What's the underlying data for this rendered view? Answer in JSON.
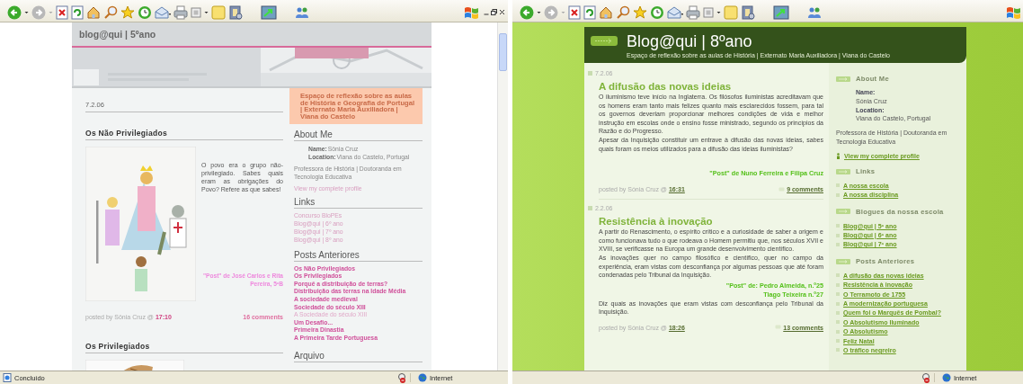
{
  "left_window": {
    "blog": {
      "title": "blog@qui | 5ºano",
      "description": "Espaço de reflexão sobre as aulas de História e Geografia de Portugal | Externato Maria Auxiliadora | Viana do Castelo",
      "date": "7.2.06",
      "posts": [
        {
          "title": "Os Não Privilegiados",
          "text": "O povo era o grupo não-privilegiado. Sabes quais eram as obrigações do Povo? Refere as que sabes!",
          "credit": "\"Post\" de José Carlos e Rita Pereira, 5ºB",
          "posted_by": "posted by Sônia Cruz @",
          "time": "17:10",
          "comments": "16 comments"
        },
        {
          "title": "Os Privilegiados"
        }
      ],
      "about": {
        "heading": "About Me",
        "name_label": "Name:",
        "name": "Sônia Cruz",
        "location_label": "Location:",
        "location": "Viana do Castelo, Portugal",
        "bio": "Professora de História | Doutoranda em Tecnologia Educativa",
        "profile_link": "View my complete profile"
      },
      "links": {
        "heading": "Links",
        "items": [
          "Concurso BloPEs",
          "Blog@qui | 6º ano",
          "Blog@qui | 7º ano",
          "Blog@qui | 8º ano"
        ]
      },
      "previous_posts": {
        "heading": "Posts Anteriores",
        "items": [
          {
            "label": "Os Não Privilegiados",
            "visited": false
          },
          {
            "label": "Os Privilegiados",
            "visited": false
          },
          {
            "label": "Porquê a distribuição de terras?",
            "visited": false
          },
          {
            "label": "Distribuição das terras na Idade Média",
            "visited": false
          },
          {
            "label": "A sociedade medieval",
            "visited": false
          },
          {
            "label": "Sociedade do século XIII",
            "visited": false
          },
          {
            "label": "A Sociedade do século XIII",
            "visited": true
          },
          {
            "label": "Um Desafio...",
            "visited": false
          },
          {
            "label": "Primeira Dinastia",
            "visited": false
          },
          {
            "label": "A Primeira Tarde Portuguesa",
            "visited": false
          }
        ]
      },
      "archive_heading": "Arquivo"
    },
    "status_bar": {
      "text": "Concluído",
      "zone": "Internet"
    }
  },
  "right_window": {
    "blog": {
      "title": "Blog@qui | 8ºano",
      "subtitle": "Espaço de reflexão sobre as aulas de História | Externato Maria Auxiliadora | Viana do Castelo",
      "posts": [
        {
          "date": "7.2.06",
          "title": "A difusão das novas ideias",
          "blocks": [
            {
              "kind": "text",
              "text": "O iluminismo teve início na Inglaterra. Os filósofos iluministas acreditavam que os homens eram tanto mais felizes quanto mais esclarecidos fossem, para tal os governos deveriam proporcionar melhores condições de vida e melhor instrução em escolas onde o ensino fosse ministrado, segundo os princípios da Razão e do Progresso."
            },
            {
              "kind": "text",
              "text": "Apesar da Inquisição constituir um entrave à difusão das novas ideias, sabes quais foram os meios utilizados para a difusão das ideias iluministas?"
            },
            {
              "kind": "credit",
              "text": "\"Post\" de Nuno Ferreira e Filipa Cruz"
            }
          ],
          "posted_by": "posted by Sónia Cruz @",
          "time": "16:31",
          "comments": "9 comments"
        },
        {
          "date": "2.2.06",
          "title": "Resistência à inovação",
          "blocks": [
            {
              "kind": "text",
              "text": "A partir do Renascimento, o espírito crítico e a curiosidade de saber a origem e como funcionava tudo o que rodeava o Homem permitiu que, nos séculos XVII e XVIII, se verificasse na Europa um grande desenvolvimento científico."
            },
            {
              "kind": "text",
              "text": "As inovações quer no campo filosófico e científico, quer no campo da experiência, eram vistas com desconfiança por algumas pessoas que até foram condenadas pelo Tribunal da Inquisição."
            },
            {
              "kind": "credit",
              "text": "\"Post\" de: Pedro Almeida, n.º25"
            },
            {
              "kind": "credit",
              "text": "Tiago Teixeira n.º27"
            },
            {
              "kind": "text",
              "text": "Diz quais as inovações que eram vistas com desconfiança pelo Tribunal da Inquisição."
            }
          ],
          "posted_by": "posted by Sónia Cruz @",
          "time": "18:26",
          "comments": "13 comments"
        }
      ],
      "about": {
        "heading": "About Me",
        "name_label": "Name:",
        "name": "Sónia Cruz",
        "location_label": "Location:",
        "location": "Viana do Castelo, Portugal",
        "bio": "Professora de História | Doutoranda em Tecnologia Educativa",
        "profile_link": "View my complete profile"
      },
      "sections": [
        {
          "heading": "Links",
          "items": [
            "A nossa escola",
            "A nossa disciplina"
          ]
        },
        {
          "heading": "Blogues da nossa escola",
          "items": [
            "Blog@qui | 5º ano",
            "Blog@qui | 6º ano",
            "Blog@qui | 7º ano"
          ]
        },
        {
          "heading": "Posts Anteriores",
          "items": [
            "A difusão das novas ideias",
            "Resistência à inovação",
            "O Terramoto de 1755",
            "A modernização portuguesa",
            "Quem foi o Marquês de Pombal?",
            "O Absolutismo Iluminado",
            "O Absolutismo",
            "Feliz Natal",
            "O tráfico negreiro"
          ]
        }
      ]
    },
    "status_bar": {
      "zone": "Internet"
    }
  }
}
